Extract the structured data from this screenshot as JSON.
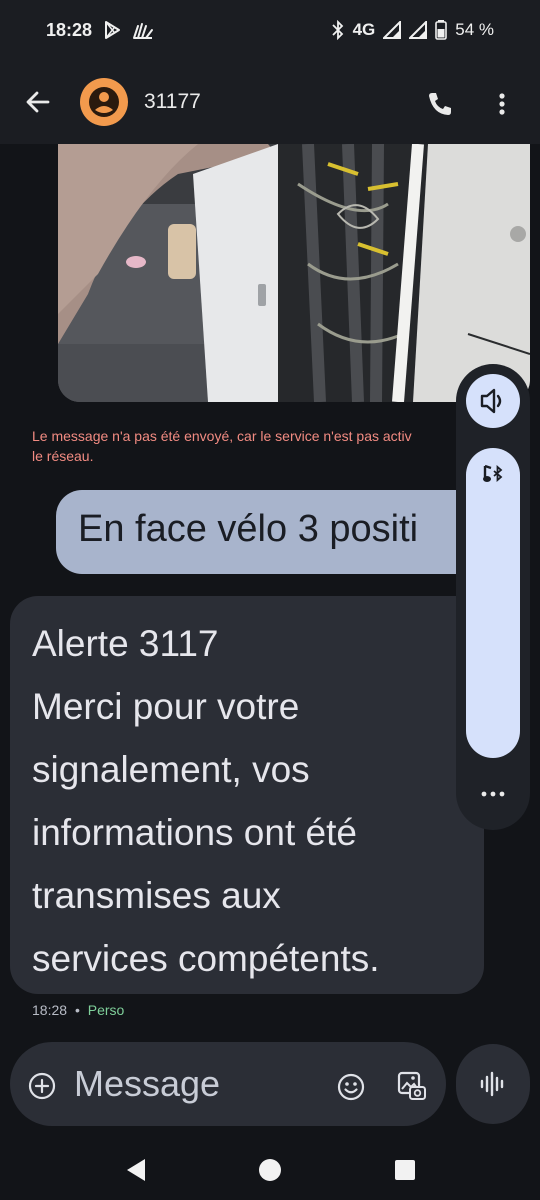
{
  "status_bar": {
    "time": "18:28",
    "network": "4G",
    "battery": "54 %",
    "left_icons": [
      "play-store-icon",
      "hand-wave-icon"
    ],
    "right_icons": [
      "bluetooth-icon",
      "signal-icon",
      "signal-icon",
      "battery-icon"
    ]
  },
  "header": {
    "contact_name": "31177",
    "avatar_color": "#f29a4d",
    "icons": [
      "back-arrow-icon",
      "person-icon",
      "phone-icon",
      "more-vert-icon"
    ]
  },
  "conversation": {
    "photo": {
      "description_icon": "photo-attachment"
    },
    "error_line1": "Le message n'a pas été envoyé, car le service n'est pas activ",
    "error_line2": "le réseau.",
    "sent_message": "En face vélo 3 positi",
    "received_lines": [
      "Alerte 3117",
      "Merci pour votre",
      "signalement, vos",
      "informations ont été",
      "transmises aux",
      "services compétents."
    ],
    "meta_time": "18:28",
    "meta_separator": "•",
    "meta_label": "Perso"
  },
  "volume_panel": {
    "icons": [
      "speaker-icon",
      "bluetooth-audio-icon",
      "more-horiz-icon"
    ],
    "level": 1.0
  },
  "compose": {
    "placeholder": "Message",
    "icons": [
      "add-circle-icon",
      "emoji-icon",
      "gallery-icon",
      "voice-waveform-icon"
    ]
  },
  "nav_bar": {
    "icons": [
      "nav-back-icon",
      "nav-home-icon",
      "nav-recents-icon"
    ]
  },
  "colors": {
    "background": "#121418",
    "sent_bubble": "#a8b4cc",
    "received_bubble": "#2b2e36",
    "error_text": "#f28b82",
    "accent_green": "#7fcf9a",
    "volume_accent": "#d6e1fb"
  }
}
